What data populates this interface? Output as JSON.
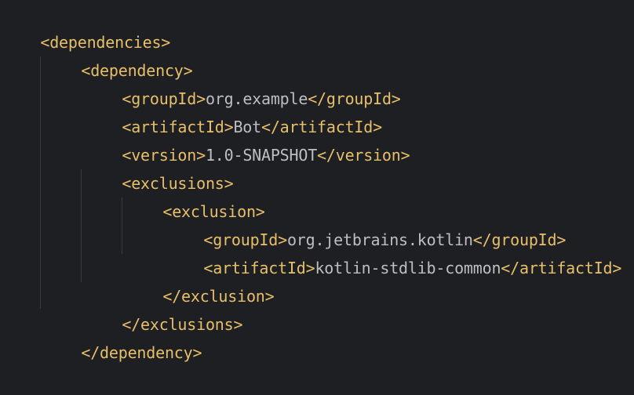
{
  "xml": {
    "dependencies_open": "<dependencies>",
    "dependency_open": "<dependency>",
    "group_id_open": "<groupId>",
    "group_id_value": "org.example",
    "group_id_close": "</groupId>",
    "artifact_id_open": "<artifactId>",
    "artifact_id_value": "Bot",
    "artifact_id_close": "</artifactId>",
    "version_open": "<version>",
    "version_value": "1.0-SNAPSHOT",
    "version_close": "</version>",
    "exclusions_open": "<exclusions>",
    "exclusion_open": "<exclusion>",
    "excl_group_id_open": "<groupId>",
    "excl_group_id_value": "org.jetbrains.kotlin",
    "excl_group_id_close": "</groupId>",
    "excl_artifact_id_open": "<artifactId>",
    "excl_artifact_id_value": "kotlin-stdlib-common",
    "excl_artifact_id_close": "</artifactId>",
    "exclusion_close": "</exclusion>",
    "exclusions_close": "</exclusions>",
    "dependency_close": "</dependency>"
  },
  "colors": {
    "background": "#1e1f22",
    "tag": "#e8bf6a",
    "text": "#bcbec4",
    "indent_guide": "#393b40"
  }
}
